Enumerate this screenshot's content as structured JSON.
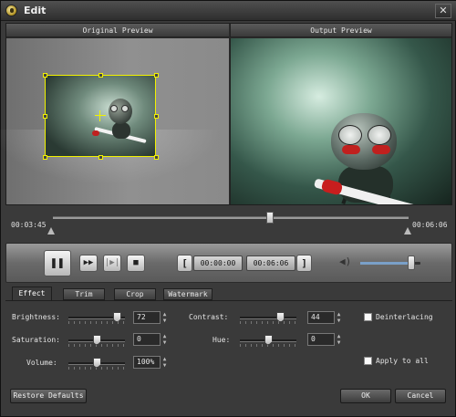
{
  "window": {
    "title": "Edit",
    "close_glyph": "✕"
  },
  "preview": {
    "original_label": "Original Preview",
    "output_label": "Output Preview"
  },
  "timeline": {
    "start_time": "00:03:45",
    "end_time": "00:06:06",
    "position_fraction": 0.61
  },
  "controls": {
    "play_pause_glyph": "❚❚",
    "fast_forward_glyph": "▶▶",
    "step_glyph": "|▶|",
    "stop_glyph": "■",
    "set_start_glyph": "[",
    "start_time": "00:00:00",
    "end_time": "00:06:06",
    "set_end_glyph": "]",
    "volume_icon_glyph": "◀)",
    "volume_fraction": 0.85
  },
  "tabs": [
    {
      "label": "Effect",
      "active": true
    },
    {
      "label": "Trim",
      "active": false
    },
    {
      "label": "Crop",
      "active": false
    },
    {
      "label": "Watermark",
      "active": false
    }
  ],
  "effect": {
    "brightness": {
      "label": "Brightness:",
      "value": "72",
      "fraction": 0.86
    },
    "contrast": {
      "label": "Contrast:",
      "value": "44",
      "fraction": 0.72
    },
    "saturation": {
      "label": "Saturation:",
      "value": "0",
      "fraction": 0.5
    },
    "hue": {
      "label": "Hue:",
      "value": "0",
      "fraction": 0.5
    },
    "volume": {
      "label": "Volume:",
      "value": "100%",
      "fraction": 0.5
    },
    "deinterlacing": {
      "label": "Deinterlacing",
      "checked": false
    },
    "apply_to_all": {
      "label": "Apply to all",
      "checked": false
    },
    "spin_up": "▲",
    "spin_down": "▼"
  },
  "buttons": {
    "restore": "Restore Defaults",
    "ok": "OK",
    "cancel": "Cancel"
  },
  "colors": {
    "crop_outline": "#f2f200",
    "window_bg": "#3a3a3a"
  }
}
